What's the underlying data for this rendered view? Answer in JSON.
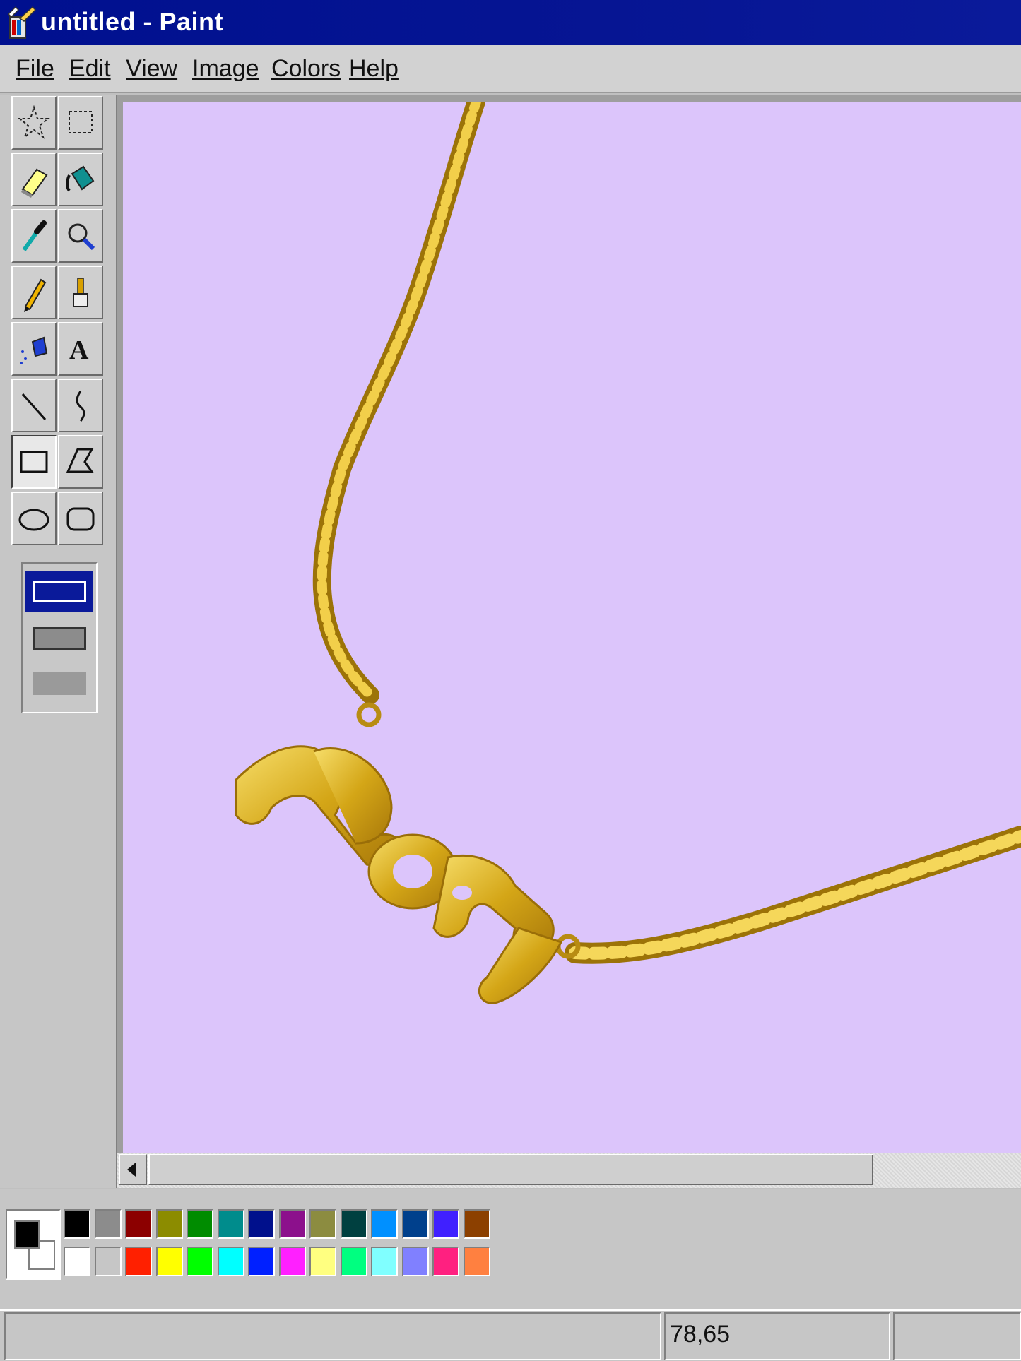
{
  "window": {
    "title": "untitled - Paint"
  },
  "menu": [
    {
      "label": "File"
    },
    {
      "label": "Edit"
    },
    {
      "label": "View"
    },
    {
      "label": "Image"
    },
    {
      "label": "Colors"
    },
    {
      "label": "Help"
    }
  ],
  "tools": [
    {
      "name": "free-form-select",
      "icon": "star-select-icon"
    },
    {
      "name": "select",
      "icon": "rect-select-icon"
    },
    {
      "name": "eraser",
      "icon": "eraser-icon"
    },
    {
      "name": "fill",
      "icon": "paint-bucket-icon"
    },
    {
      "name": "pick-color",
      "icon": "eyedropper-icon"
    },
    {
      "name": "magnifier",
      "icon": "magnifier-icon"
    },
    {
      "name": "pencil",
      "icon": "pencil-icon"
    },
    {
      "name": "brush",
      "icon": "brush-icon"
    },
    {
      "name": "airbrush",
      "icon": "airbrush-icon"
    },
    {
      "name": "text",
      "icon": "text-icon"
    },
    {
      "name": "line",
      "icon": "line-icon"
    },
    {
      "name": "curve",
      "icon": "curve-icon"
    },
    {
      "name": "rectangle",
      "icon": "rectangle-icon",
      "active": true
    },
    {
      "name": "polygon",
      "icon": "polygon-icon"
    },
    {
      "name": "ellipse",
      "icon": "ellipse-icon"
    },
    {
      "name": "rounded-rectangle",
      "icon": "rounded-rect-icon"
    }
  ],
  "canvas": {
    "background": "#dcc5fb",
    "content": "gold-necklace-with-mom-pendant"
  },
  "palette": {
    "foreground": "#000000",
    "background": "#ffffff",
    "colors_top": [
      "#000000",
      "#8c8c8c",
      "#8c0000",
      "#8c8c00",
      "#008c00",
      "#008c8c",
      "#00108c",
      "#8c108c",
      "#8c8c40",
      "#004040",
      "#0090ff",
      "#00408c",
      "#4020ff",
      "#8c4000"
    ],
    "colors_bottom": [
      "#ffffff",
      "#c6c6c6",
      "#ff2000",
      "#ffff00",
      "#00ff00",
      "#00ffff",
      "#0020ff",
      "#ff20ff",
      "#ffff80",
      "#00ff80",
      "#80ffff",
      "#8080ff",
      "#ff2080",
      "#ff8040"
    ]
  },
  "status": {
    "coordinates": "78,65"
  }
}
